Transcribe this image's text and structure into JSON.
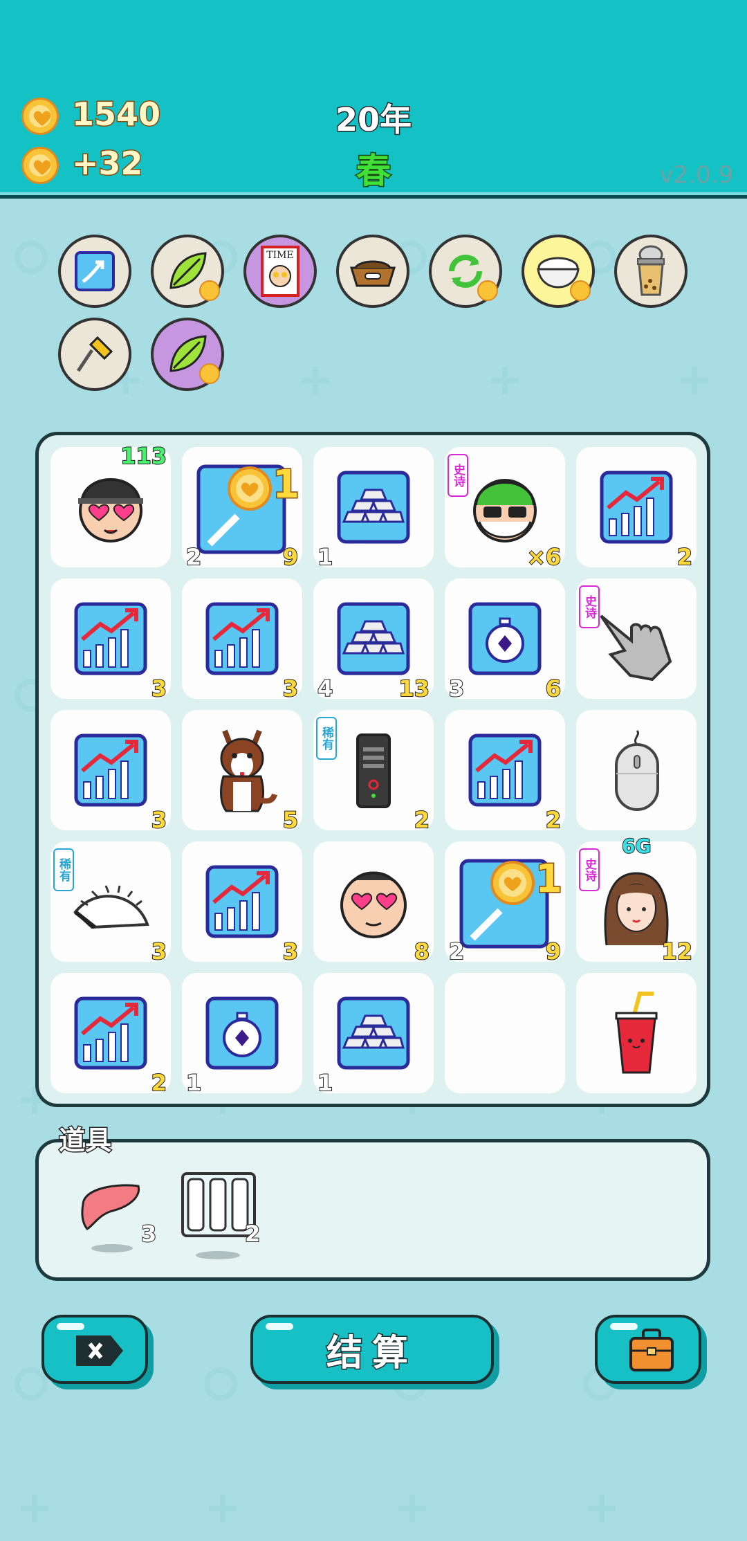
{
  "header": {
    "money": "1540",
    "income": "+32",
    "year": "20年",
    "season": "春",
    "version": "v2.0.9"
  },
  "badges": [
    {
      "name": "up-arrow-card-badge"
    },
    {
      "name": "leaf-badge"
    },
    {
      "name": "time-magazine-badge"
    },
    {
      "name": "dog-bowl-badge"
    },
    {
      "name": "recycle-badge"
    },
    {
      "name": "rice-bowl-badge"
    },
    {
      "name": "bubble-tea-badge"
    },
    {
      "name": "screwdriver-badge"
    },
    {
      "name": "leaf-purple-badge"
    }
  ],
  "cells": [
    {
      "icon": "lover-face",
      "tr": "113"
    },
    {
      "icon": "coin-magnifier",
      "bl": "2",
      "br": "9",
      "big": "1"
    },
    {
      "icon": "gold-bars",
      "bl": "1"
    },
    {
      "icon": "old-man-glasses",
      "tag": "史诗",
      "br": "×6"
    },
    {
      "icon": "growth-chart",
      "br": "2"
    },
    {
      "icon": "growth-chart",
      "br": "3"
    },
    {
      "icon": "growth-chart",
      "br": "3"
    },
    {
      "icon": "gold-bars",
      "bl": "4",
      "br": "13"
    },
    {
      "icon": "stopwatch",
      "bl": "3",
      "br": "6"
    },
    {
      "icon": "pointing-hand",
      "tag": "史诗"
    },
    {
      "icon": "growth-chart",
      "br": "3"
    },
    {
      "icon": "husky-dog",
      "br": "5"
    },
    {
      "icon": "server",
      "tag": "稀有",
      "br": "2"
    },
    {
      "icon": "growth-chart",
      "br": "2"
    },
    {
      "icon": "computer-mouse"
    },
    {
      "icon": "speedometer",
      "tag": "稀有",
      "br": "3"
    },
    {
      "icon": "growth-chart",
      "br": "3"
    },
    {
      "icon": "lover-face-bald",
      "br": "8"
    },
    {
      "icon": "coin-magnifier",
      "bl": "2",
      "br": "9",
      "big": "1"
    },
    {
      "icon": "girl",
      "tag": "史诗",
      "top": "6G",
      "br": "12"
    },
    {
      "icon": "growth-chart",
      "br": "2"
    },
    {
      "icon": "stopwatch",
      "bl": "1"
    },
    {
      "icon": "gold-bars",
      "bl": "1"
    },
    {
      "icon": "empty"
    },
    {
      "icon": "soda-cup"
    }
  ],
  "tools": {
    "title": "道具",
    "items": [
      {
        "icon": "liver",
        "count": "3"
      },
      {
        "icon": "test-tube-rack",
        "count": "2"
      }
    ]
  },
  "buttons": {
    "settle": "结算"
  },
  "colors": {
    "header": "#14c1c4",
    "background": "#a9dde4",
    "board": "#def1f1",
    "accent_yellow": "#ffd93b"
  }
}
